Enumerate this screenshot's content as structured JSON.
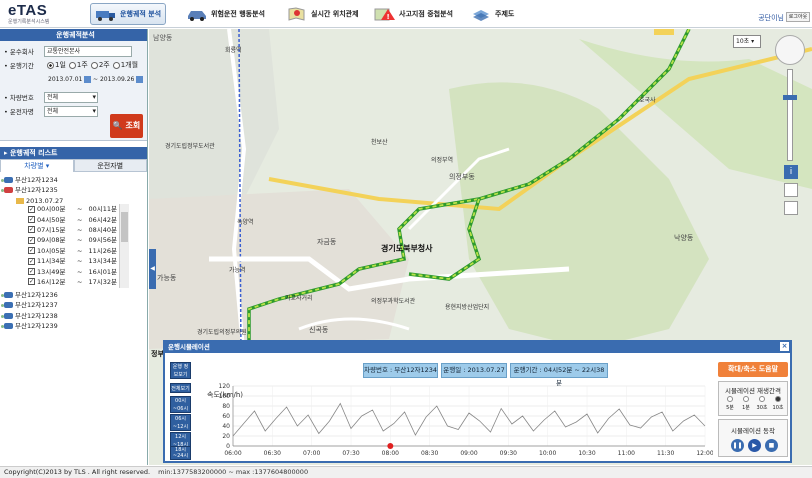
{
  "app": {
    "logo": "eTAS",
    "logo_sub": "운행기록분석시스템"
  },
  "nav": [
    "운행궤적 분석",
    "위험운전 행동분석",
    "실시간 위치관제",
    "사고지점 중첩분석",
    "주제도"
  ],
  "user": {
    "name": "공단이님",
    "logout": "로그아웃"
  },
  "search": {
    "title": "운행궤적분석",
    "company_label": "운수회사",
    "company_value": "교통안전본사",
    "period_label": "운행기간",
    "period_options": [
      "1일",
      "1주",
      "2주",
      "1개월"
    ],
    "date_from": "2013.07.01",
    "date_to": "2013.09.26",
    "vehicle_label": "차량번호",
    "vehicle_value": "전체",
    "driver_label": "운전자명",
    "driver_value": "전체",
    "query_button": "조회"
  },
  "list": {
    "title": "운행궤적 리스트",
    "tabs": [
      "차량별",
      "운전자별"
    ],
    "vehicles": [
      "부산12자1234",
      "부산12자1235",
      "부산12자1236",
      "부산12자1237",
      "부산12자1238",
      "부산12자1239"
    ],
    "date": "2013.07.27",
    "trips": [
      {
        "start": "00시00분",
        "end": "00시11분"
      },
      {
        "start": "04시50분",
        "end": "06시42분"
      },
      {
        "start": "07시15분",
        "end": "08시40분"
      },
      {
        "start": "09시08분",
        "end": "09시56분"
      },
      {
        "start": "10시05분",
        "end": "11시26분"
      },
      {
        "start": "11시34분",
        "end": "13시34분"
      },
      {
        "start": "13시49분",
        "end": "16시01분"
      },
      {
        "start": "16시12분",
        "end": "17시32분"
      }
    ]
  },
  "map": {
    "labels": [
      "남양동",
      "호국사",
      "천보산",
      "의정부역",
      "의정부동",
      "자금동",
      "경기도북부청사",
      "의정부과학도서관",
      "경기도립의정부의원",
      "신곡동",
      "가능동",
      "녹양역",
      "가능역",
      "회룡역",
      "정부역",
      "가교사거리",
      "용현지방산업단지",
      "낙양동",
      "경기도립정부도서관"
    ],
    "scale": "10초"
  },
  "popup": {
    "title": "운행시뮬레이션",
    "vehicle_info": "차량번호 : 부산12자1234",
    "date_info": "운행일 : 2013.07.27",
    "period_info": "운행기간 : 04시52분 ~ 22시38분",
    "zoom_button": "확대/축소 도움말",
    "speed_title": "시뮬레이션 재생간격",
    "speed_options": [
      "5분",
      "1분",
      "30초",
      "10초"
    ],
    "play_title": "시뮬레이션 동작",
    "left_buttons": [
      "운행 정보보기",
      "전체보기",
      "00시~06시",
      "06시~12시",
      "12시~18시",
      "18시~24시"
    ]
  },
  "chart_data": {
    "type": "line",
    "ylabel": "속도(km/h)",
    "ylim": [
      0,
      120
    ],
    "yticks": [
      0,
      20,
      40,
      60,
      80,
      100,
      120
    ],
    "x": [
      "06:00",
      "06:30",
      "07:00",
      "07:30",
      "08:00",
      "08:30",
      "09:00",
      "09:30",
      "10:00",
      "10:30",
      "11:00",
      "11:30",
      "12:00"
    ],
    "marker": "08:00",
    "series": [
      {
        "values": [
          20,
          45,
          70,
          30,
          55,
          78,
          40,
          62,
          25,
          50,
          85,
          35,
          60,
          72,
          30,
          45,
          68,
          22,
          58,
          80,
          40,
          33,
          66,
          50,
          28,
          75,
          44,
          60,
          30,
          52,
          70,
          38,
          48,
          64,
          26,
          55,
          74,
          42,
          36,
          58,
          68,
          30,
          50,
          62,
          40
        ]
      }
    ]
  },
  "footer": {
    "copyright": "Copyright(C)2013 by TLS . All right reserved.",
    "minmax": "min:1377583200000 ~ max :1377604800000"
  }
}
